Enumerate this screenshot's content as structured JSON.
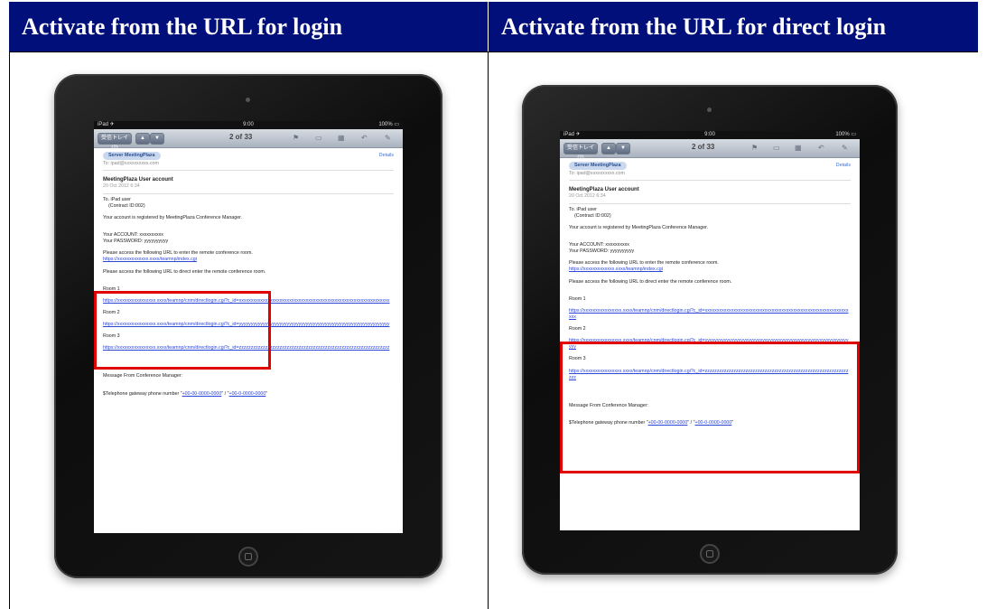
{
  "headers": {
    "left": "Activate from the URL for login",
    "right": "Activate from the URL for direct login"
  },
  "ipad": {
    "status_left": "iPad ✈",
    "status_center": "9:00",
    "status_right": "100% ▭",
    "toolbar": {
      "back_label": "受信トレイ(2)",
      "up_arrow": "▲",
      "down_arrow": "▼",
      "count": "2 of 33",
      "flag_icon": "⚑",
      "folder_icon": "▭",
      "trash_icon": "▦",
      "reply_icon": "↶",
      "compose_icon": "✎"
    },
    "email": {
      "from": "Server MeetingPlaza",
      "details": "Details",
      "to": "To: ipad@xxxxxxxxxx.com",
      "subject": "MeetingPlaza User account",
      "date": "20 Oct 2012 6:34",
      "greeting_1": "To. iPad user",
      "greeting_2": "(Contract ID:002)",
      "registered": "Your account is registered by MeetingPlaza Conference Manager.",
      "account": "Your ACCOUNT:   xxxxxxxxxx",
      "password": "Your PASSWORD:  yyyyyyyyyy",
      "access_text": "Please access the following URL to enter the remote conference room.",
      "access_link": "https://xxxxxxxxxxxxx.xxxx/teamnp/index.cgi",
      "direct_text": "Please access the following URL to direct enter the remote conference room.",
      "room1": "Room 1",
      "room1_link": "https://xxxxxxxxxxxxxxxx.xxxx/teamnp/cnm/directlogin.cgi?c_id=xxxxxxxxxxxxxxxxxxxxxxxxxxxxxxxxxxxxxxxxxxxxxxxxxxxxxxxxxxxxxxx",
      "room2": "Room 2",
      "room2_link": "https://xxxxxxxxxxxxxxxx.xxxx/teamnp/cnm/directlogin.cgi?c_id=yyyyyyyyyyyyyyyyyyyyyyyyyyyyyyyyyyyyyyyyyyyyyyyyyyyyyyyyyyyyyyy",
      "room3": "Room 3",
      "room3_link": "https://xxxxxxxxxxxxxxxx.xxxx/teamnp/cnm/directlogin.cgi?c_id=zzzzzzzzzzzzzzzzzzzzzzzzzzzzzzzzzzzzzzzzzzzzzzzzzzzzzzzzzzzzzzz",
      "message_from": "Message From Conference Manager:",
      "telephone_text": "$Telephone gateway phone number \"",
      "telephone_link1": "+00-00-0000-0000",
      "telephone_mid": "\" / \"",
      "telephone_link2": "+00-0-0000-0000",
      "telephone_end": "\""
    }
  },
  "colors": {
    "header_bg": "#000f7a",
    "highlight": "#e00000",
    "link": "#2a45d8"
  }
}
